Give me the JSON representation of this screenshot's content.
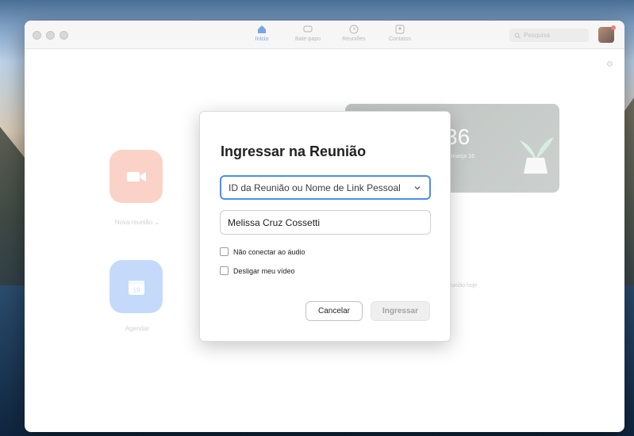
{
  "nav": {
    "tabs": [
      {
        "label": "Início",
        "icon": "home-icon",
        "active": true
      },
      {
        "label": "Bate-papo",
        "icon": "chat-icon",
        "active": false
      },
      {
        "label": "Reuniões",
        "icon": "clock-icon",
        "active": false
      },
      {
        "label": "Contatos",
        "icon": "contacts-icon",
        "active": false
      }
    ],
    "search_placeholder": "Pesquisa"
  },
  "home": {
    "new_meeting_label": "Nova reunião ⌄",
    "schedule_label": "Agendar",
    "calendar_day": "19",
    "clock_time": "36",
    "clock_date": "a, março 16",
    "no_meetings_text": "ma reunião hoje"
  },
  "dialog": {
    "title": "Ingressar na Reunião",
    "meeting_id_placeholder": "ID da Reunião ou Nome de Link Pessoal",
    "name_value": "Melissa Cruz Cossetti",
    "checkbox_no_audio": "Não conectar ao áudio",
    "checkbox_video_off": "Desligar meu vídeo",
    "cancel_label": "Cancelar",
    "join_label": "Ingressar"
  },
  "colors": {
    "accent": "#4a8ef0",
    "orange_tile": "#f2714f",
    "blue_tile": "#4a8bf0"
  }
}
